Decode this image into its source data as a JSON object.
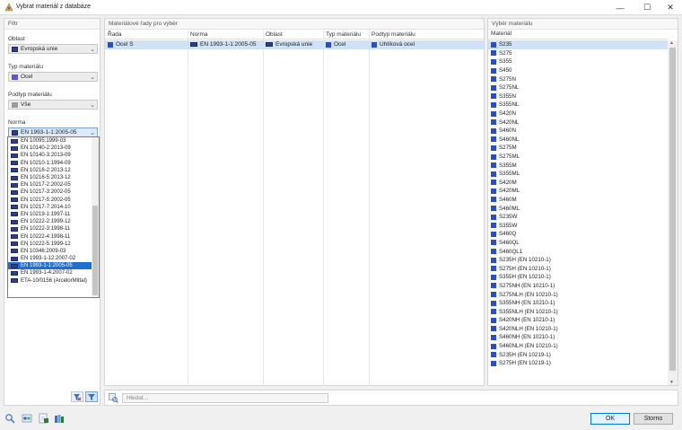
{
  "window": {
    "title": "Vybrat materiál z databáze",
    "min": "—",
    "max": "☐",
    "close": "✕"
  },
  "filter": {
    "header": "Filtr",
    "oblast_label": "Oblast",
    "oblast_value": "Evropská unie",
    "typ_label": "Typ materiálu",
    "typ_value": "Ocel",
    "podtyp_label": "Podtyp materiálu",
    "podtyp_value": "Vše",
    "norma_label": "Norma",
    "norma_value": "EN 1993-1-1:2005-05",
    "norma_options": [
      "EN 10095:1999-03",
      "EN 10140-2:2013-09",
      "EN 10140-3:2013-09",
      "EN 10210-1:1994-09",
      "EN 10216-2:2013-12",
      "EN 10216-5:2013-12",
      "EN 10217-2:2002-05",
      "EN 10217-3:2002-05",
      "EN 10217-5:2002-05",
      "EN 10217-7:2014-10",
      "EN 10219-1:1997-11",
      "EN 10222-2:1999-12",
      "EN 10222-3:1998-11",
      "EN 10222-4:1998-11",
      "EN 10222-5:1999-12",
      "EN 10346:2009-03",
      "EN 1993-1-12:2007-02",
      "EN 1993-1-1:2005-05",
      "EN 1993-1-4:2007-02",
      "ETA-10/0156 (ArcelorMittal)"
    ],
    "norma_selected_index": 17
  },
  "center": {
    "header": "Materiálové řady pro výběr",
    "columns": [
      "Řada",
      "Norma",
      "Oblast",
      "Typ materiálu",
      "Podtyp materiálu"
    ],
    "row": {
      "rada": "Ocel S",
      "norma": "EN 1993-1-1:2005-05",
      "oblast": "Evropská unie",
      "typ": "Ocel",
      "podtyp": "Uhlíková ocel"
    }
  },
  "search": {
    "placeholder": "Hledat..."
  },
  "materials": {
    "header": "Výběr materiálu",
    "column": "Materiál",
    "items": [
      "S235",
      "S275",
      "S355",
      "S450",
      "S275N",
      "S275NL",
      "S355N",
      "S355NL",
      "S420N",
      "S420NL",
      "S460N",
      "S460NL",
      "S275M",
      "S275ML",
      "S355M",
      "S355ML",
      "S420M",
      "S420ML",
      "S460M",
      "S460ML",
      "S235W",
      "S355W",
      "S460Q",
      "S460QL",
      "S460QL1",
      "S235H (EN 10210-1)",
      "S275H (EN 10210-1)",
      "S355H (EN 10210-1)",
      "S275NH (EN 10210-1)",
      "S275NLH (EN 10210-1)",
      "S355NH (EN 10210-1)",
      "S355NLH (EN 10210-1)",
      "S420NH (EN 10210-1)",
      "S420NLH (EN 10210-1)",
      "S460NH (EN 10210-1)",
      "S460NLH (EN 10210-1)",
      "S235H (EN 10219-1)",
      "S275H (EN 10219-1)"
    ],
    "selected_index": 0
  },
  "buttons": {
    "ok": "OK",
    "cancel": "Storno"
  },
  "colors": {
    "accent": "#1f6fd1",
    "selection": "#cfe2f7",
    "steel_blue": "#2a4ec9",
    "eu_flag": "#2a3f8f",
    "swatch_purple": "#6a4fd8",
    "swatch_gray": "#9a9a9a"
  }
}
